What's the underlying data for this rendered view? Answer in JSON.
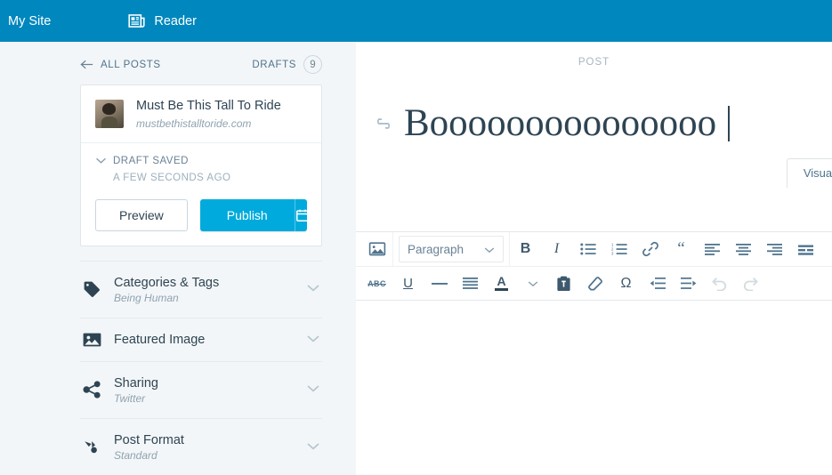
{
  "masthead": {
    "my_site_label": "My Site",
    "reader_label": "Reader",
    "background_color": "#0087be"
  },
  "sidebar": {
    "all_posts_label": "ALL POSTS",
    "drafts_label": "DRAFTS",
    "drafts_count": "9",
    "site": {
      "title": "Must Be This Tall To Ride",
      "url": "mustbethistalltoride.com"
    },
    "status": {
      "label": "DRAFT SAVED",
      "timestamp": "A FEW SECONDS AGO"
    },
    "actions": {
      "preview_label": "Preview",
      "publish_label": "Publish",
      "publish_color": "#00aadc"
    },
    "panels": [
      {
        "label": "Categories & Tags",
        "sub": "Being Human",
        "icon": "tag-icon"
      },
      {
        "label": "Featured Image",
        "sub": "",
        "icon": "image-icon"
      },
      {
        "label": "Sharing",
        "sub": "Twitter",
        "icon": "share-icon"
      },
      {
        "label": "Post Format",
        "sub": "Standard",
        "icon": "post-format-icon"
      }
    ]
  },
  "editor": {
    "kicker": "POST",
    "title_value": "Booooooooooooooo",
    "visual_tab_label": "Visual",
    "toolbar_row1": [
      {
        "name": "add-media-icon",
        "label": ""
      },
      {
        "name": "paragraph-select",
        "label": "Paragraph"
      },
      {
        "name": "bold-icon",
        "label": "B"
      },
      {
        "name": "italic-icon",
        "label": "I"
      },
      {
        "name": "bullet-list-icon",
        "label": ""
      },
      {
        "name": "numbered-list-icon",
        "label": ""
      },
      {
        "name": "link-icon",
        "label": ""
      },
      {
        "name": "blockquote-icon",
        "label": "“"
      },
      {
        "name": "align-left-icon",
        "label": ""
      },
      {
        "name": "align-center-icon",
        "label": ""
      },
      {
        "name": "align-right-icon",
        "label": ""
      },
      {
        "name": "align-justify-icon",
        "label": ""
      }
    ],
    "toolbar_row2": [
      {
        "name": "strikethrough-icon",
        "label": "ABC"
      },
      {
        "name": "underline-icon",
        "label": "U"
      },
      {
        "name": "horizontal-rule-icon",
        "label": ""
      },
      {
        "name": "justify-icon",
        "label": ""
      },
      {
        "name": "text-color-icon",
        "label": "A"
      },
      {
        "name": "paste-as-text-icon",
        "label": ""
      },
      {
        "name": "clear-formatting-icon",
        "label": ""
      },
      {
        "name": "special-character-icon",
        "label": "Ω"
      },
      {
        "name": "outdent-icon",
        "label": ""
      },
      {
        "name": "indent-icon",
        "label": ""
      },
      {
        "name": "undo-icon",
        "label": ""
      },
      {
        "name": "redo-icon",
        "label": ""
      }
    ]
  }
}
